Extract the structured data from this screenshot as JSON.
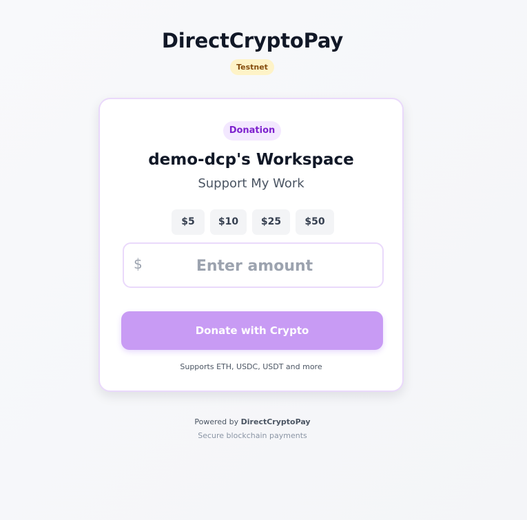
{
  "header": {
    "title": "DirectCryptoPay",
    "environment_badge": "Testnet"
  },
  "card": {
    "type_badge": "Donation",
    "workspace_name": "demo-dcp's Workspace",
    "subtitle": "Support My Work",
    "presets": [
      "$5",
      "$10",
      "$25",
      "$50"
    ],
    "amount_prefix": "$",
    "amount_value": "",
    "amount_placeholder": "Enter amount",
    "donate_button_label": "Donate with Crypto",
    "supported_assets_text": "Supports ETH, USDC, USDT and more"
  },
  "footer": {
    "powered_prefix": "Powered by ",
    "powered_brand": "DirectCryptoPay",
    "secure_text": "Secure blockchain payments"
  },
  "colors": {
    "primary_purple": "#c89bf4",
    "badge_purple_bg": "#f3e8ff",
    "badge_purple_text": "#7e22ce",
    "testnet_bg": "#fef3c7",
    "testnet_text": "#854d0e"
  }
}
